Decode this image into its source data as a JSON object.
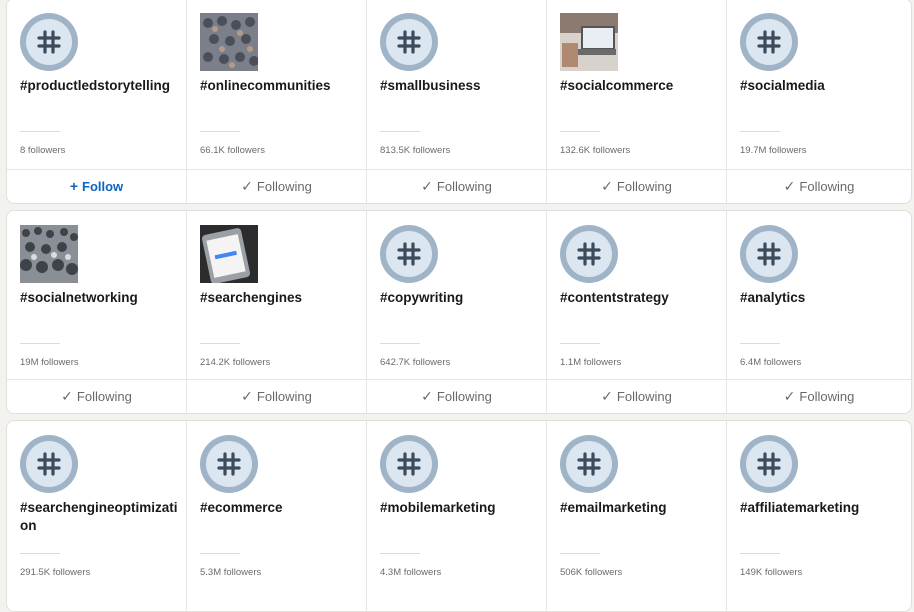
{
  "hashtags": [
    {
      "tag": "#productledstorytelling",
      "followers": "8 followers",
      "action": "Follow",
      "action_icon": "plus",
      "thumb": "hashtag"
    },
    {
      "tag": "#onlinecommunities",
      "followers": "66.1K followers",
      "action": "Following",
      "action_icon": "check",
      "thumb": "photo-crowd"
    },
    {
      "tag": "#smallbusiness",
      "followers": "813.5K followers",
      "action": "Following",
      "action_icon": "check",
      "thumb": "hashtag"
    },
    {
      "tag": "#socialcommerce",
      "followers": "132.6K followers",
      "action": "Following",
      "action_icon": "check",
      "thumb": "photo-laptop"
    },
    {
      "tag": "#socialmedia",
      "followers": "19.7M followers",
      "action": "Following",
      "action_icon": "check",
      "thumb": "hashtag"
    },
    {
      "tag": "#socialnetworking",
      "followers": "19M followers",
      "action": "Following",
      "action_icon": "check",
      "thumb": "photo-crowd2"
    },
    {
      "tag": "#searchengines",
      "followers": "214.2K followers",
      "action": "Following",
      "action_icon": "check",
      "thumb": "photo-phone"
    },
    {
      "tag": "#copywriting",
      "followers": "642.7K followers",
      "action": "Following",
      "action_icon": "check",
      "thumb": "hashtag"
    },
    {
      "tag": "#contentstrategy",
      "followers": "1.1M followers",
      "action": "Following",
      "action_icon": "check",
      "thumb": "hashtag"
    },
    {
      "tag": "#analytics",
      "followers": "6.4M followers",
      "action": "Following",
      "action_icon": "check",
      "thumb": "hashtag"
    },
    {
      "tag": "#searchengineoptimization",
      "followers": "291.5K followers",
      "action": "",
      "action_icon": "",
      "thumb": "hashtag"
    },
    {
      "tag": "#ecommerce",
      "followers": "5.3M followers",
      "action": "",
      "action_icon": "",
      "thumb": "hashtag"
    },
    {
      "tag": "#mobilemarketing",
      "followers": "4.3M followers",
      "action": "",
      "action_icon": "",
      "thumb": "hashtag"
    },
    {
      "tag": "#emailmarketing",
      "followers": "506K followers",
      "action": "",
      "action_icon": "",
      "thumb": "hashtag"
    },
    {
      "tag": "#affiliatemarketing",
      "followers": "149K followers",
      "action": "",
      "action_icon": "",
      "thumb": "hashtag"
    }
  ],
  "colors": {
    "accent": "#0a66c2",
    "hashtag_ring": "#a0b4c8",
    "hashtag_fill": "#dce6f1"
  }
}
